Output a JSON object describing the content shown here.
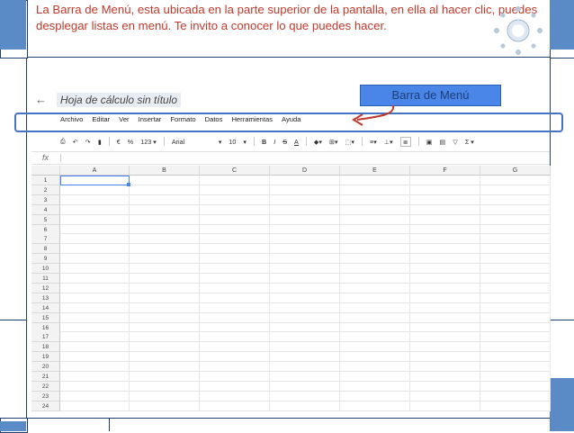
{
  "caption": "La Barra de Menú, esta ubicada en la parte superior de la pantalla, en ella al hacer clic, puedes desplegar listas en menú.  Te invito a conocer lo que puedes hacer.",
  "callout_label": "Barra de Menú",
  "document": {
    "title": "Hoja de cálculo sin título"
  },
  "menu": [
    "Archivo",
    "Editar",
    "Ver",
    "Insertar",
    "Formato",
    "Datos",
    "Herramientas",
    "Ayuda"
  ],
  "toolbar": {
    "currency": "€",
    "percent": "%",
    "number_format": "123 ▾",
    "font": "Arial",
    "font_size": "10",
    "bold": "B",
    "italic": "I",
    "strike": "S",
    "text_color": "A",
    "sum": "Σ ▾"
  },
  "formula_bar": {
    "fx_label": "fx"
  },
  "columns": [
    "A",
    "B",
    "C",
    "D",
    "E",
    "F",
    "G"
  ],
  "rows": [
    "1",
    "2",
    "3",
    "4",
    "5",
    "6",
    "7",
    "8",
    "9",
    "10",
    "11",
    "12",
    "13",
    "14",
    "15",
    "16",
    "17",
    "18",
    "19",
    "20",
    "21",
    "22",
    "23",
    "24"
  ],
  "colors": {
    "caption": "#c0392b",
    "accent": "#4472c4",
    "callout_bg": "#4a86e8",
    "selection": "#4285f4",
    "frame": "#1f3f6e"
  }
}
